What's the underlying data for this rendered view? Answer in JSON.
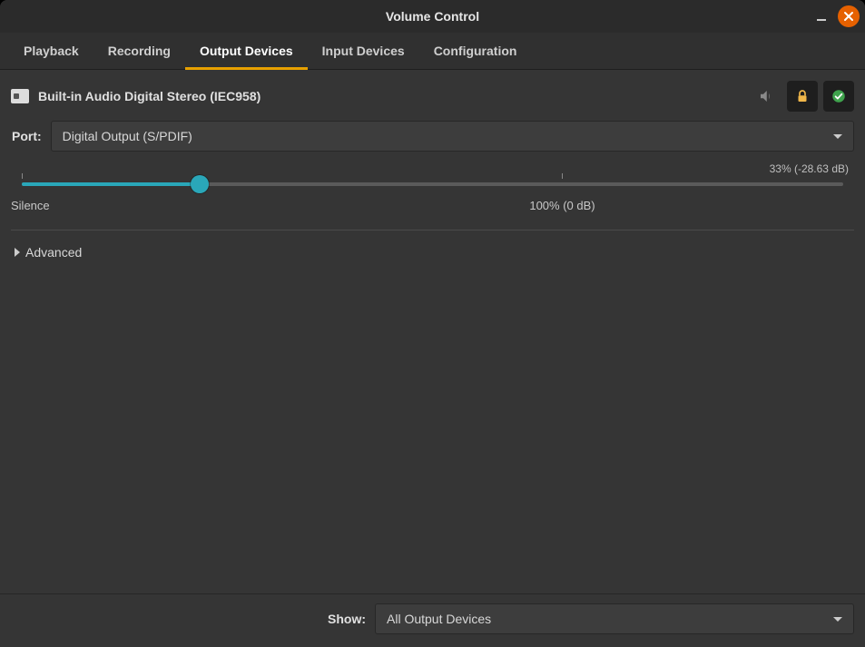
{
  "window": {
    "title": "Volume Control"
  },
  "tabs": {
    "items": [
      {
        "label": "Playback"
      },
      {
        "label": "Recording"
      },
      {
        "label": "Output Devices"
      },
      {
        "label": "Input Devices"
      },
      {
        "label": "Configuration"
      }
    ],
    "active_index": 2
  },
  "device": {
    "name": "Built-in Audio Digital Stereo (IEC958)"
  },
  "port": {
    "label": "Port:",
    "value": "Digital Output (S/PDIF)"
  },
  "volume": {
    "percent_label": "33% (-28.63 dB)",
    "silence_label": "Silence",
    "hundred_label": "100% (0 dB)",
    "fill_pct": 21.7,
    "max_pct_pos": 65.8
  },
  "advanced": {
    "label": "Advanced"
  },
  "footer": {
    "show_label": "Show:",
    "show_value": "All Output Devices"
  }
}
